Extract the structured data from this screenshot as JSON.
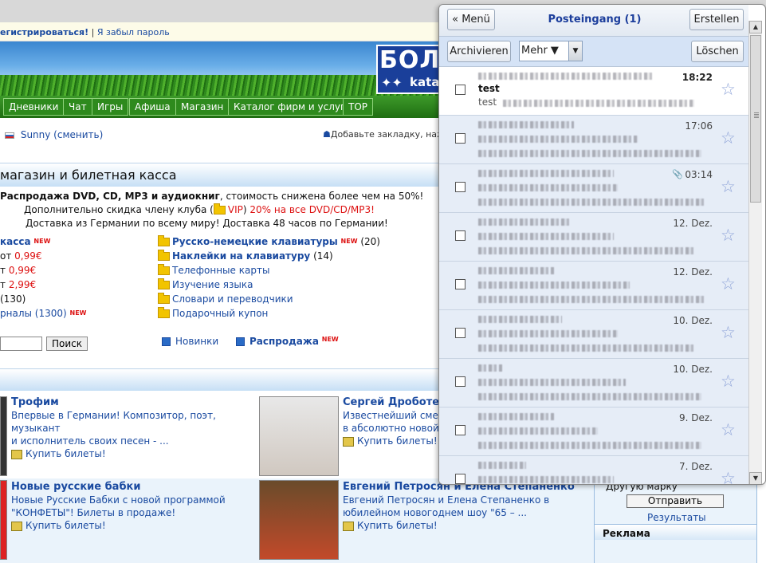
{
  "login": {
    "register": "егистрироваться!",
    "sep": "|",
    "forgot": "Я забыл пароль"
  },
  "logo": {
    "big": "БОЛЬ",
    "small": "kata"
  },
  "nav": [
    "Дневники",
    "Чат",
    "Игры",
    "Афиша",
    "Магазин",
    "Каталог фирм и услуг",
    "TOP"
  ],
  "user": {
    "name": "Sunny (сменить)",
    "bookmark": "Добавьте закладку, наж"
  },
  "section_title": "магазин и билетная касса",
  "promo": {
    "line1_bold": "Распродажа DVD, CD, MP3 и аудиокниг",
    "line1_rest": ", стоимость снижена более чем на 50%!",
    "line2_a": "Дополнительно скидка члену клуба (",
    "line2_vip": "VIP",
    "line2_b": ") ",
    "line2_red": "20% на все DVD/CD/MP3!",
    "line3": "Доставка из Германии по всему миру! Доставка 48 часов по Германии!"
  },
  "left_cats": [
    {
      "text": "касса",
      "bold": true,
      "new": "NEW"
    },
    {
      "text": "от ",
      "price": "0,99€"
    },
    {
      "text": "т ",
      "price": "0,99€"
    },
    {
      "text": "т ",
      "price": "2,99€"
    },
    {
      "text": "(130)"
    },
    {
      "text": "рналы (1300)",
      "new": "NEW"
    }
  ],
  "right_cats": [
    {
      "text": "Русско-немецкие клавиатуры",
      "bold": true,
      "new": "NEW",
      "count": " (20)"
    },
    {
      "text": "Наклейки на клавиатуру",
      "bold": true,
      "count": " (14)"
    },
    {
      "text": "Телефонные карты"
    },
    {
      "text": "Изучение языка"
    },
    {
      "text": "Словари и переводчики"
    },
    {
      "text": "Подарочный купон"
    }
  ],
  "search_btn": "Поиск",
  "links": {
    "news": "Новинки",
    "sale": "Распродажа",
    "sale_new": "NEW"
  },
  "events": [
    {
      "title": "Трофим",
      "desc1": "Впервые в Германии! Композитор, поэт, музыкант",
      "desc2": "и исполнитель своих песен - ...",
      "buy": "Купить билеты!"
    },
    {
      "title": "Сергей Дроботенко",
      "desc1": "Известнейший смехо",
      "desc2": "в абсолютно новой",
      "buy": "Купить билеты!"
    },
    {
      "title": "Новые русские бабки",
      "desc1": "Новые Русские Бабки с новой программой",
      "desc2": "\"КОНФЕТЫ\"! Билеты в продаже!",
      "buy": "Купить билеты!"
    },
    {
      "title": "Евгений Петросян и Елена Степаненко",
      "desc1": "Евгений Петросян и Елена Степаненко в",
      "desc2": "юбилейном новогоднем шоу \"65 – ...",
      "buy": "Купить билеты!"
    }
  ],
  "right_panel": {
    "other": "Другую марку",
    "send": "Отправить",
    "results": "Результаты",
    "ad": "Реклама"
  },
  "gmail": {
    "menu": "« Menü",
    "title": "Posteingang (1)",
    "compose": "Erstellen",
    "archive": "Archivieren",
    "more": "Mehr ▼",
    "delete": "Löschen",
    "messages": [
      {
        "time": "18:22",
        "subject": "test",
        "preview": "test",
        "unread": true
      },
      {
        "time": "17:06",
        "unread": false
      },
      {
        "time": "03:14",
        "attachment": true,
        "unread": false
      },
      {
        "time": "12. Dez.",
        "unread": false
      },
      {
        "time": "12. Dez.",
        "unread": false
      },
      {
        "time": "10. Dez.",
        "unread": false
      },
      {
        "time": "10. Dez.",
        "unread": false
      },
      {
        "time": "9. Dez.",
        "unread": false
      },
      {
        "time": "7. Dez.",
        "unread": false
      }
    ]
  }
}
